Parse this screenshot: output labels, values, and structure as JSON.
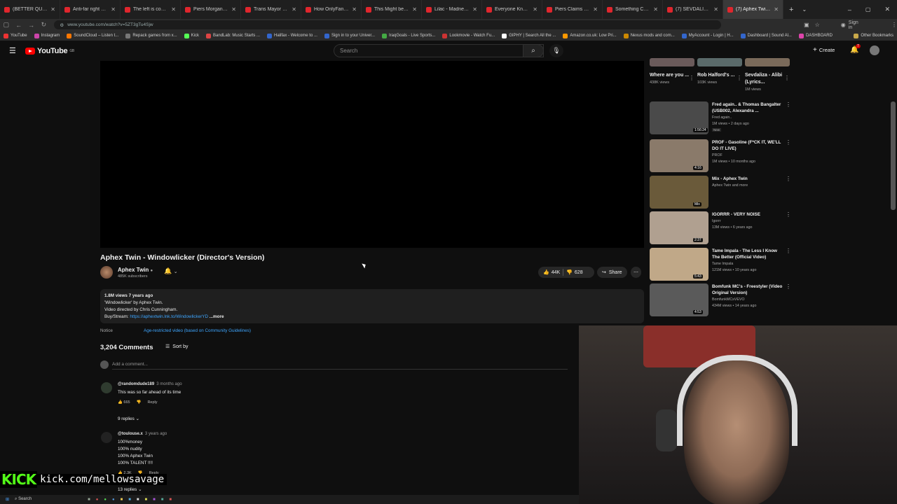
{
  "browser": {
    "tabs": [
      {
        "title": "(BETTER QUALITY) Li"
      },
      {
        "title": "Anti-far right march c"
      },
      {
        "title": "The left is completely"
      },
      {
        "title": "Piers Morgan Presses"
      },
      {
        "title": "Trans Mayor MELTS D"
      },
      {
        "title": "How OnlyFans Ruined"
      },
      {
        "title": "This Might be Most In"
      },
      {
        "title": "Lilac - Madness Offic"
      },
      {
        "title": "Everyone Knows Trou"
      },
      {
        "title": "Piers Claims Muslims"
      },
      {
        "title": "Something Changed"
      },
      {
        "title": "(7) SEVDALIZA - SHA"
      },
      {
        "title": "(7) Aphex Twin - Wind"
      }
    ],
    "url": "www.youtube.com/watch?v=5ZT3gTu4Sjw",
    "signin": "Sign in",
    "bookmarks": [
      "YouTube",
      "Instagram",
      "SoundCloud – Listen t...",
      "Repack games from x...",
      "Kick",
      "BandLab: Music Starts ...",
      "Halifax - Welcome to ...",
      "Sign in to your Univer...",
      "IraqGoals - Live Sports...",
      "Lookmovie - Watch Fu...",
      "GIPHY | Search All the ...",
      "Amazon.co.uk: Low Pri...",
      "Nexus mods and com...",
      "MyAccount - Login | H...",
      "Dashboard | Sound Al...",
      "DASHBOARD"
    ],
    "other_bookmarks": "Other Bookmarks"
  },
  "yt": {
    "logo": "YouTube",
    "region": "GB",
    "search_placeholder": "Search",
    "create": "Create",
    "notif_count": "7"
  },
  "video": {
    "title": "Aphex Twin - Windowlicker (Director's Version)",
    "channel": "Aphex Twin",
    "subs": "485K subscribers",
    "likes": "44K",
    "dislikes": "628",
    "share": "Share",
    "desc_line1": "1.8M views  7 years ago",
    "desc_line2": "'Windowlicker' by Aphex Twin.",
    "desc_line3": "Video directed by Chris Cunningham.",
    "desc_buy": "Buy/Stream: ",
    "desc_link": "https://aphextwin.lnk.to/WindowlickerYD",
    "desc_more": " ...more",
    "notice_label": "Notice",
    "notice_link": "Age-restricted video (based on Community Guidelines)"
  },
  "comments": {
    "count": "3,204 Comments",
    "sort": "Sort by",
    "add_placeholder": "Add a comment...",
    "items": [
      {
        "user": "@randomdude189",
        "age": "3 months ago",
        "text": "This was so far ahead of its time",
        "likes": "665",
        "reply": "Reply",
        "replies": "9 replies"
      },
      {
        "user": "@toulouse.x",
        "age": "3 years ago",
        "text": "100%money\n100% nudity\n100% Aphex Twin\n100% TALENT !!!!",
        "likes": "2.3K",
        "reply": "Reply",
        "replies": "13 replies"
      }
    ]
  },
  "shorts": [
    {
      "title": "Where are you ...",
      "views": "438K views"
    },
    {
      "title": "Rob Halford's ...",
      "views": "103K views"
    },
    {
      "title": "Sevdaliza - Alibi (Lyrics...",
      "views": "1M views"
    }
  ],
  "recommended": [
    {
      "title": "Fred again.. & Thomas Bangalter (USB002, Alexandra ...",
      "channel": "Fred again..",
      "meta": "1M views • 2 days ago",
      "dur": "1:56:24",
      "badge": "New",
      "color": "#4a4a4a"
    },
    {
      "title": "PROF - Gasoline (F*CK IT, WE'LL DO IT LIVE)",
      "channel": "PROF",
      "meta": "1M views • 10 months ago",
      "dur": "4:16",
      "badge": "",
      "color": "#8a7a6a"
    },
    {
      "title": "Mix - Aphex Twin",
      "channel": "Aphex Twin and more",
      "meta": "",
      "dur": "Mix",
      "badge": "",
      "color": "#6a5a3a"
    },
    {
      "title": "IGORRR - VERY NOISE",
      "channel": "Igorrr",
      "meta": "13M views • 6 years ago",
      "dur": "2:37",
      "badge": "",
      "color": "#b0a090"
    },
    {
      "title": "Tame Impala - The Less I Know The Better (Official Video)",
      "channel": "Tame Impala",
      "meta": "121M views • 10 years ago",
      "dur": "5:43",
      "badge": "",
      "color": "#c0a888"
    },
    {
      "title": "Bomfunk MC's - Freestyler (Video Original Version)",
      "channel": "BomfunkMCsVEVO",
      "meta": "434M views • 14 years ago",
      "dur": "4:53",
      "badge": "",
      "color": "#5a5a5a"
    }
  ],
  "stream": {
    "kick_logo": "KICK",
    "kick_url": "kick.com/mellowsavage"
  },
  "taskbar": {
    "search": "Search"
  }
}
